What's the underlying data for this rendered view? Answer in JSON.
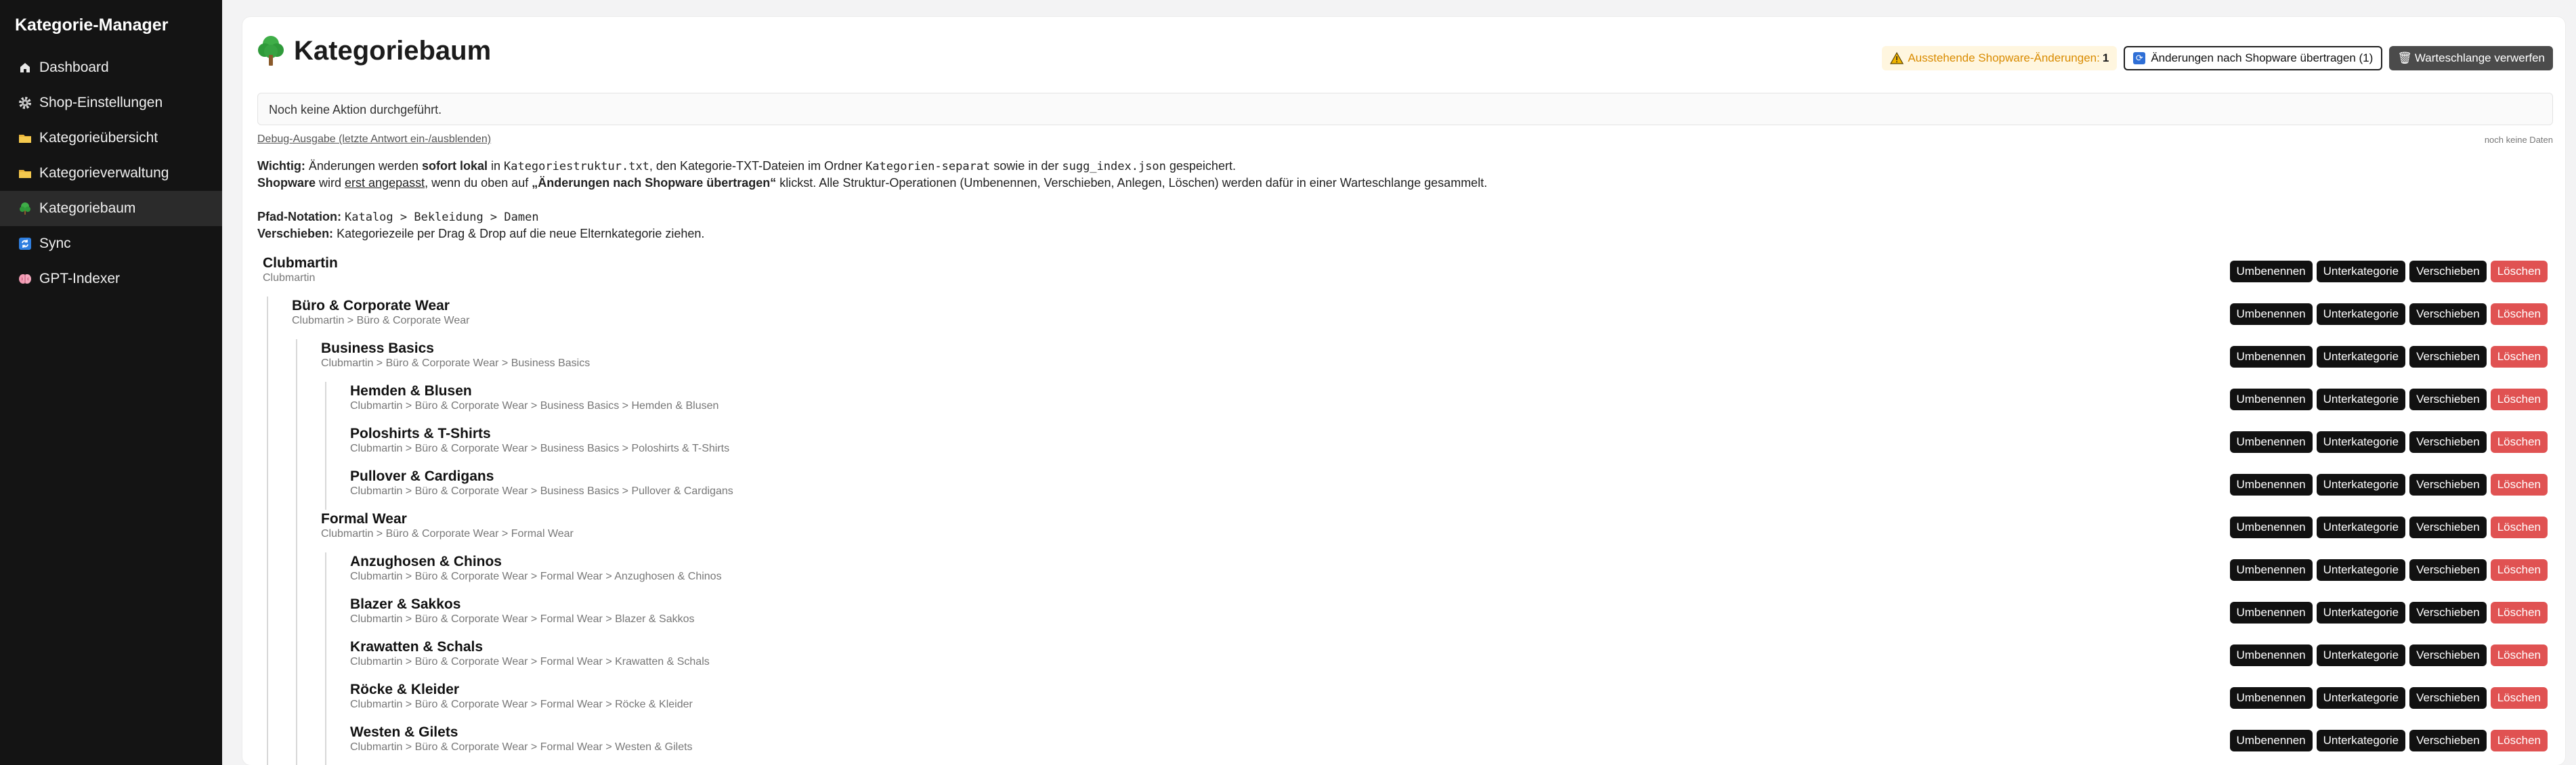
{
  "app": {
    "title": "Kategorie-Manager"
  },
  "sidebar": {
    "items": [
      {
        "label": "Dashboard",
        "icon": "home-icon"
      },
      {
        "label": "Shop-Einstellungen",
        "icon": "gear-icon"
      },
      {
        "label": "Kategorieübersicht",
        "icon": "folder-icon"
      },
      {
        "label": "Kategorieverwaltung",
        "icon": "folder-icon"
      },
      {
        "label": "Kategoriebaum",
        "icon": "tree-icon",
        "active": true
      },
      {
        "label": "Sync",
        "icon": "sync-icon"
      },
      {
        "label": "GPT-Indexer",
        "icon": "brain-icon"
      }
    ]
  },
  "header": {
    "title": "Kategoriebaum",
    "pending_label": "Ausstehende Shopware-Änderungen:",
    "pending_count": "1",
    "push_label": "Änderungen nach Shopware übertragen (1)",
    "discard_label": "Warteschlange verwerfen",
    "discard_icon": "🗑"
  },
  "status": {
    "message": "Noch keine Aktion durchgeführt."
  },
  "debug": {
    "toggle_label": "Debug-Ausgabe (letzte Antwort ein-/ausblenden)",
    "empty_label": "noch keine Daten"
  },
  "info": {
    "l1_a": "Wichtig:",
    "l1_b": " Änderungen werden ",
    "l1_c": "sofort lokal",
    "l1_d": " in ",
    "l1_e": "Kategoriestruktur.txt",
    "l1_f": ", den Kategorie-TXT-Dateien im Ordner ",
    "l1_g": "Kategorien-separat",
    "l1_h": " sowie in der ",
    "l1_i": "sugg_index.json",
    "l1_j": " gespeichert.",
    "l2_a": "Shopware",
    "l2_b": " wird ",
    "l2_c": "erst angepasst",
    "l2_d": ", wenn du oben auf ",
    "l2_e": "„Änderungen nach Shopware übertragen“",
    "l2_f": " klickst. Alle Struktur-Operationen (Umbenennen, Verschieben, Anlegen, Löschen) werden dafür in einer Warteschlange gesammelt.",
    "l3_a": "Pfad-Notation:",
    "l3_b": "Katalog > Bekleidung > Damen",
    "l4_a": "Verschieben:",
    "l4_b": " Kategoriezeile per Drag & Drop auf die neue Elternkategorie ziehen."
  },
  "row_actions": {
    "rename": "Umbenennen",
    "sub": "Unterkategorie",
    "move": "Verschieben",
    "delete": "Löschen"
  },
  "tree": [
    {
      "name": "Clubmartin",
      "path": "Clubmartin",
      "level": 0
    },
    {
      "name": "Büro & Corporate Wear",
      "path": "Clubmartin > Büro & Corporate Wear",
      "level": 1
    },
    {
      "name": "Business Basics",
      "path": "Clubmartin > Büro & Corporate Wear > Business Basics",
      "level": 2
    },
    {
      "name": "Hemden & Blusen",
      "path": "Clubmartin > Büro & Corporate Wear > Business Basics > Hemden & Blusen",
      "level": 3
    },
    {
      "name": "Poloshirts & T-Shirts",
      "path": "Clubmartin > Büro & Corporate Wear > Business Basics > Poloshirts & T-Shirts",
      "level": 3
    },
    {
      "name": "Pullover & Cardigans",
      "path": "Clubmartin > Büro & Corporate Wear > Business Basics > Pullover & Cardigans",
      "level": 3
    },
    {
      "name": "Formal Wear",
      "path": "Clubmartin > Büro & Corporate Wear > Formal Wear",
      "level": 2
    },
    {
      "name": "Anzughosen & Chinos",
      "path": "Clubmartin > Büro & Corporate Wear > Formal Wear > Anzughosen & Chinos",
      "level": 3
    },
    {
      "name": "Blazer & Sakkos",
      "path": "Clubmartin > Büro & Corporate Wear > Formal Wear > Blazer & Sakkos",
      "level": 3
    },
    {
      "name": "Krawatten & Schals",
      "path": "Clubmartin > Büro & Corporate Wear > Formal Wear > Krawatten & Schals",
      "level": 3
    },
    {
      "name": "Röcke & Kleider",
      "path": "Clubmartin > Büro & Corporate Wear > Formal Wear > Röcke & Kleider",
      "level": 3
    },
    {
      "name": "Westen & Gilets",
      "path": "Clubmartin > Büro & Corporate Wear > Formal Wear > Westen & Gilets",
      "level": 3
    }
  ]
}
